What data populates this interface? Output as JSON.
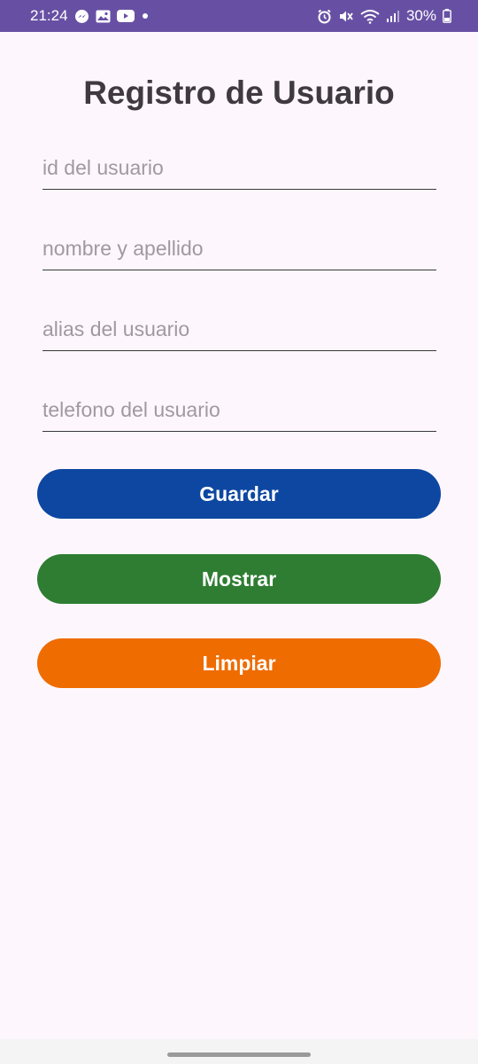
{
  "status_bar": {
    "time": "21:24",
    "battery": "30%",
    "left_icons": [
      "messenger-icon",
      "gallery-icon",
      "youtube-icon",
      "dot-icon"
    ],
    "right_icons": [
      "alarm-icon",
      "mute-icon",
      "wifi-icon",
      "signal-icon",
      "battery-icon"
    ]
  },
  "form": {
    "title": "Registro de Usuario",
    "fields": {
      "id": {
        "placeholder": "id del usuario",
        "value": ""
      },
      "name": {
        "placeholder": "nombre y apellido",
        "value": ""
      },
      "alias": {
        "placeholder": "alias del usuario",
        "value": ""
      },
      "phone": {
        "placeholder": "telefono del usuario",
        "value": ""
      }
    },
    "buttons": {
      "save": {
        "label": "Guardar",
        "color": "#0d47a1"
      },
      "show": {
        "label": "Mostrar",
        "color": "#2e7d32"
      },
      "clear": {
        "label": "Limpiar",
        "color": "#ef6c00"
      }
    }
  },
  "colors": {
    "status_bar": "#6750a4",
    "background": "#fdf7fd",
    "title": "#3f3a40"
  }
}
